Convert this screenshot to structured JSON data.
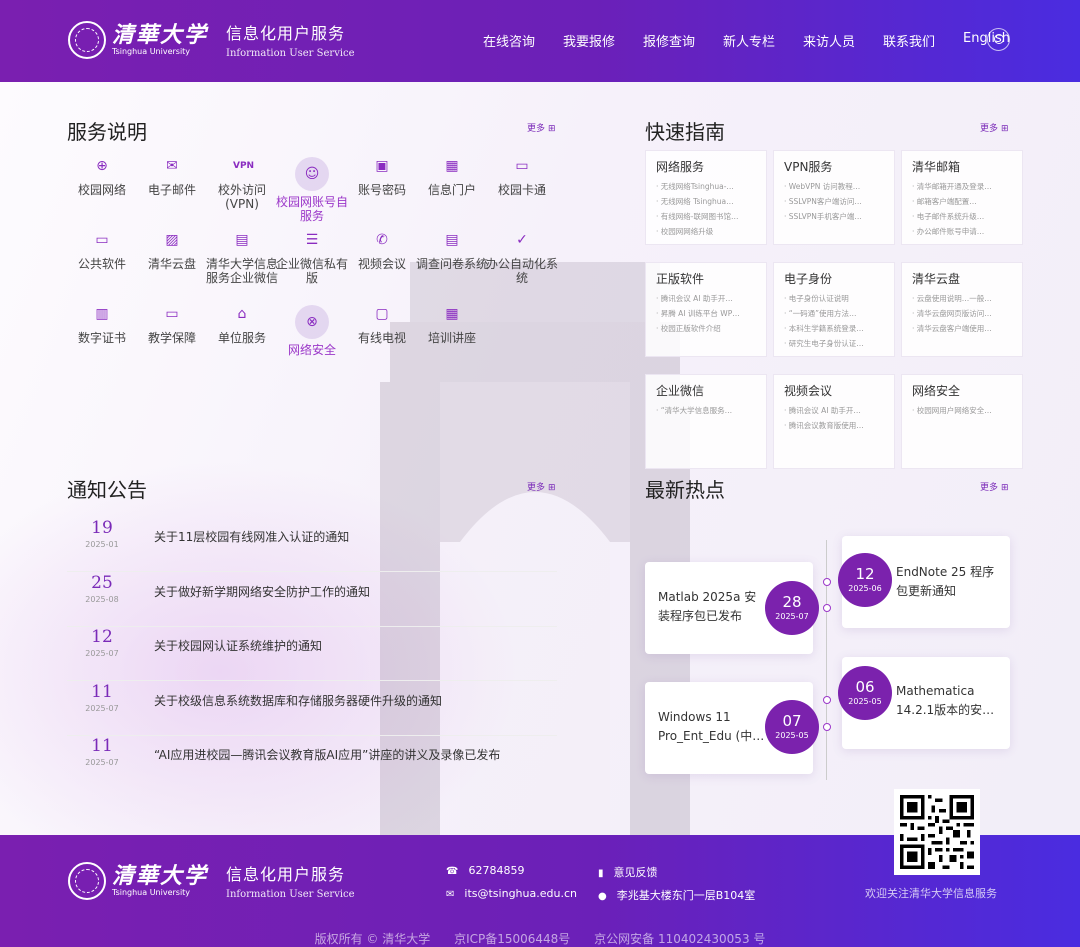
{
  "header": {
    "logo_text": "清華大学",
    "logo_en": "Tsinghua University",
    "service_title": "信息化用户服务",
    "service_sub": "Information User Service",
    "nav": [
      "在线咨询",
      "我要报修",
      "报修查询",
      "新人专栏",
      "来访人员",
      "联系我们",
      "English"
    ]
  },
  "services": {
    "title": "服务说明",
    "more": "更多",
    "items": [
      {
        "label": "校园网络",
        "icon": "globe-icon"
      },
      {
        "label": "电子邮件",
        "icon": "mail-icon"
      },
      {
        "label": "校外访问(VPN)",
        "icon": "vpn-icon"
      },
      {
        "label": "校园网账号自服务",
        "icon": "user-icon"
      },
      {
        "label": "账号密码",
        "icon": "id-card-icon"
      },
      {
        "label": "信息门户",
        "icon": "portal-icon"
      },
      {
        "label": "校园卡通",
        "icon": "card-icon"
      },
      {
        "label": "公共软件",
        "icon": "monitor-icon"
      },
      {
        "label": "清华云盘",
        "icon": "image-icon"
      },
      {
        "label": "清华大学信息服务企业微信",
        "icon": "doc-icon"
      },
      {
        "label": "企业微信私有版",
        "icon": "server-icon"
      },
      {
        "label": "视频会议",
        "icon": "phone-icon"
      },
      {
        "label": "调查问卷系统",
        "icon": "survey-icon"
      },
      {
        "label": "办公自动化系统",
        "icon": "shield-check-icon"
      },
      {
        "label": "数字证书",
        "icon": "certificate-icon"
      },
      {
        "label": "教学保障",
        "icon": "teaching-icon"
      },
      {
        "label": "单位服务",
        "icon": "graduation-icon"
      },
      {
        "label": "网络安全",
        "icon": "security-icon"
      },
      {
        "label": "有线电视",
        "icon": "tv-icon"
      },
      {
        "label": "培训讲座",
        "icon": "lecture-icon"
      }
    ]
  },
  "guide": {
    "title": "快速指南",
    "more": "更多",
    "cards": [
      {
        "title": "网络服务",
        "items": [
          "无线网络Tsinghua-…",
          "无线网络 Tsinghua…",
          "有线网络-联网图书馆…",
          "校园网网络升级"
        ]
      },
      {
        "title": "VPN服务",
        "items": [
          "WebVPN 访问教程…",
          "SSLVPN客户端访问…",
          "SSLVPN手机客户端…"
        ]
      },
      {
        "title": "清华邮箱",
        "items": [
          "清华邮箱开通及登录…",
          "邮箱客户端配置…",
          "电子邮件系统升级…",
          "办公邮件账号申请…"
        ]
      },
      {
        "title": "正版软件",
        "items": [
          "腾讯会议 AI 助手开…",
          "昇腾 AI 训练平台 WP…",
          "校园正版软件介绍"
        ]
      },
      {
        "title": "电子身份",
        "items": [
          "电子身份认证说明",
          "“一码通”使用方法…",
          "本科生学籍系统登录…",
          "研究生电子身份认证…"
        ]
      },
      {
        "title": "清华云盘",
        "items": [
          "云盘使用说明…一般…",
          "清华云盘网页版访问…",
          "清华云盘客户端使用…"
        ]
      },
      {
        "title": "企业微信",
        "items": [
          "“清华大学信息服务…"
        ]
      },
      {
        "title": "视频会议",
        "items": [
          "腾讯会议 AI 助手开…",
          "腾讯会议教育版使用…"
        ]
      },
      {
        "title": "网络安全",
        "items": [
          "校园网用户网络安全…"
        ]
      }
    ]
  },
  "notices": {
    "title": "通知公告",
    "more": "更多",
    "items": [
      {
        "day": "19",
        "ym": "2025-01",
        "text": "关于11层校园有线网准入认证的通知"
      },
      {
        "day": "25",
        "ym": "2025-08",
        "text": "关于做好新学期网络安全防护工作的通知"
      },
      {
        "day": "12",
        "ym": "2025-07",
        "text": "关于校园网认证系统维护的通知"
      },
      {
        "day": "11",
        "ym": "2025-07",
        "text": "关于校级信息系统数据库和存储服务器硬件升级的通知"
      },
      {
        "day": "11",
        "ym": "2025-07",
        "text": "“AI应用进校园—腾讯会议教育版AI应用”讲座的讲义及录像已发布"
      }
    ]
  },
  "hot": {
    "title": "最新热点",
    "more": "更多",
    "items": [
      {
        "day": "12",
        "ym": "2025-06",
        "text": "EndNote 25 程序包更新通知"
      },
      {
        "day": "28",
        "ym": "2025-07",
        "text": "Matlab 2025a 安装程序包已发布"
      },
      {
        "day": "06",
        "ym": "2025-05",
        "text": "Mathematica 14.2.1版本的安…"
      },
      {
        "day": "07",
        "ym": "2025-05",
        "text": "Windows 11 Pro_Ent_Edu (中…"
      }
    ]
  },
  "footer": {
    "logo_text": "清華大学",
    "logo_en": "Tsinghua University",
    "service_title": "信息化用户服务",
    "service_sub": "Information User Service",
    "phone": "62784859",
    "email": "its@tsinghua.edu.cn",
    "feedback": "意见反馈",
    "address": "李兆基大楼东门一层B104室",
    "follow": "欢迎关注清华大学信息服务",
    "copyright": "版权所有 © 清华大学",
    "icp": "京ICP备15006448号",
    "police": "京公网安备 110402430053 号"
  }
}
